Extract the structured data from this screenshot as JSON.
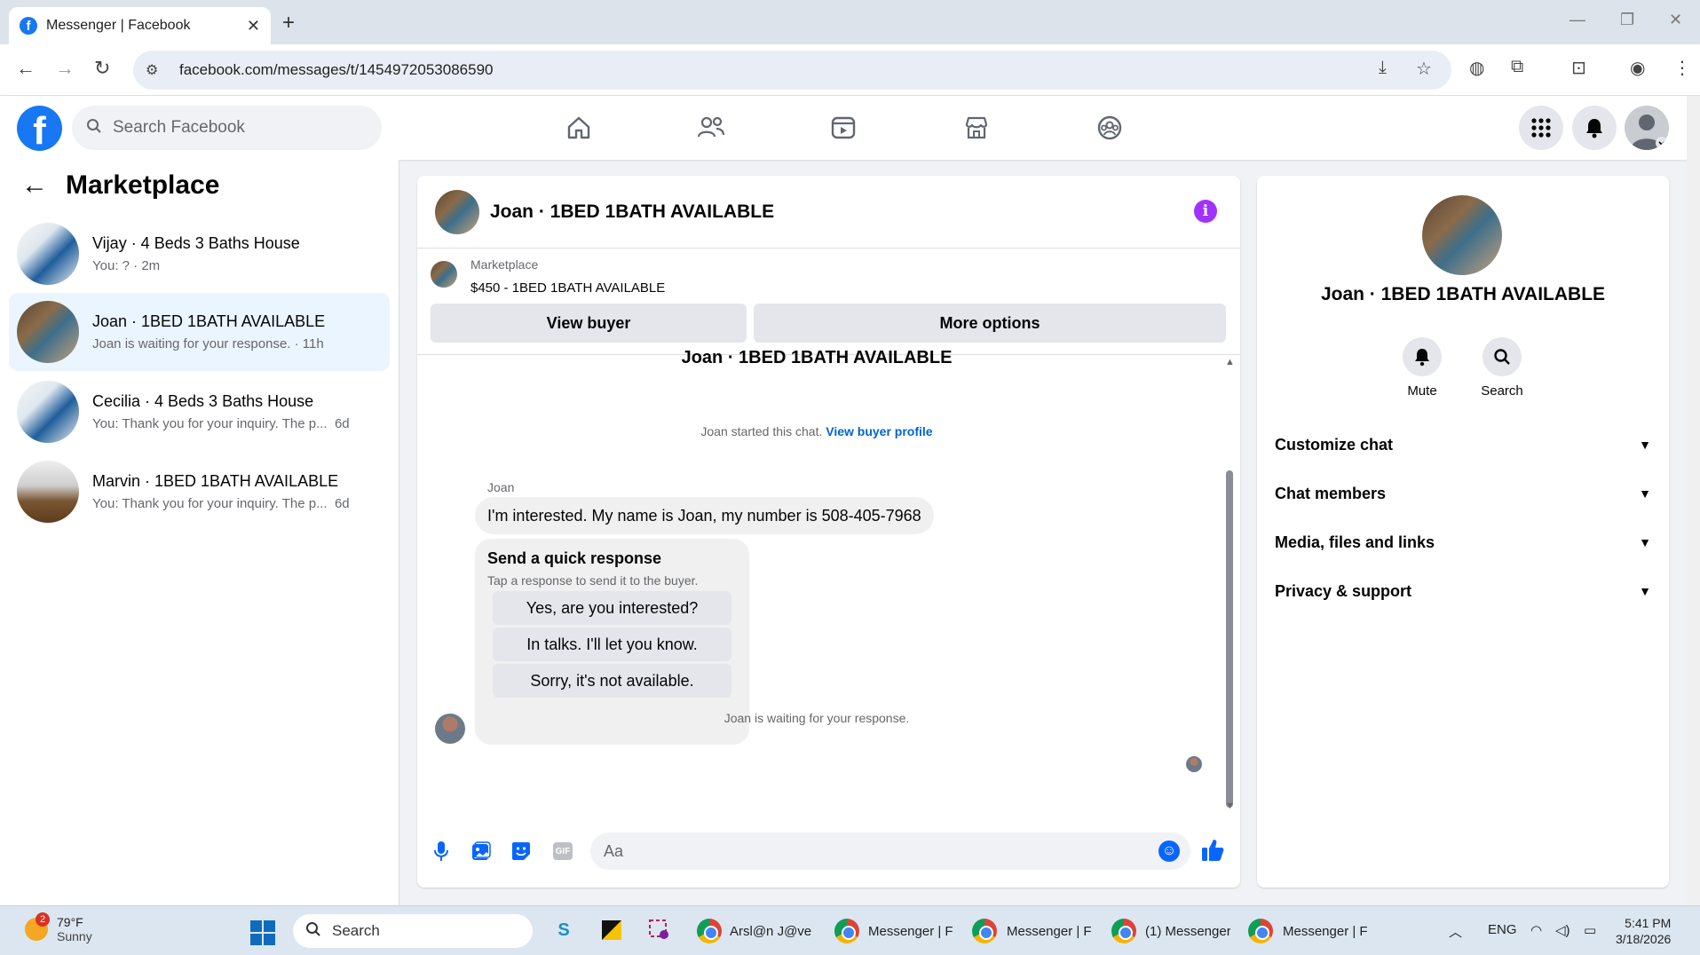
{
  "browser": {
    "tab_title": "Messenger | Facebook",
    "url": "facebook.com/messages/t/1454972053086590"
  },
  "fb": {
    "search_placeholder": "Search Facebook"
  },
  "sidebar": {
    "title": "Marketplace",
    "conversations": [
      {
        "name": "Vijay · 4 Beds 3 Baths House",
        "preview": "You: ? · 2m"
      },
      {
        "name": "Joan · 1BED 1BATH AVAILABLE",
        "preview": "Joan is waiting for your response. · 11h"
      },
      {
        "name": "Cecilia · 4 Beds 3 Baths House",
        "preview": "You: Thank you for your inquiry. The p...",
        "time": "6d"
      },
      {
        "name": "Marvin · 1BED 1BATH AVAILABLE",
        "preview": "You: Thank you for your inquiry. The p...",
        "time": "6d"
      }
    ]
  },
  "chat": {
    "title": "Joan · 1BED 1BATH AVAILABLE",
    "marketplace_label": "Marketplace",
    "listing": "$450 - 1BED 1BATH AVAILABLE",
    "view_buyer": "View buyer",
    "more_options": "More options",
    "cut_title": "Joan · 1BED 1BATH AVAILABLE",
    "started": "Joan started this chat.",
    "view_profile": "View buyer profile",
    "sender": "Joan",
    "message": "I'm interested. My name is Joan, my number is 508-405-7968",
    "quick_title": "Send a quick response",
    "quick_sub": "Tap a response to send it to the buyer.",
    "quick_options": [
      "Yes, are you interested?",
      "In talks. I'll let you know.",
      "Sorry, it's not available."
    ],
    "waiting": "Joan is waiting for your response.",
    "composer_placeholder": "Aa",
    "gif_label": "GIF"
  },
  "info": {
    "name": "Joan · 1BED 1BATH AVAILABLE",
    "mute": "Mute",
    "search": "Search",
    "sections": [
      "Customize chat",
      "Chat members",
      "Media, files and links",
      "Privacy & support"
    ]
  },
  "taskbar": {
    "badge": "2",
    "temp": "79°F",
    "weather": "Sunny",
    "search": "Search",
    "apps": [
      "Arsl@n J@ve",
      "Messenger | F",
      "Messenger | F",
      "(1) Messenger",
      "Messenger | F"
    ],
    "lang": "ENG",
    "time": "5:41 PM",
    "date": "3/18/2026"
  }
}
